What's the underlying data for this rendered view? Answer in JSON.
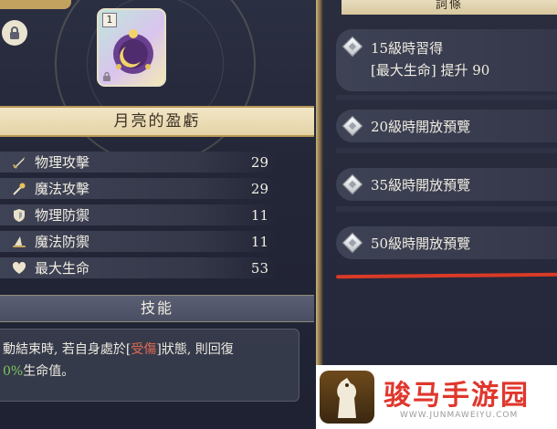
{
  "card": {
    "count": "1"
  },
  "item": {
    "name": "月亮的盈虧"
  },
  "stats": [
    {
      "label": "物理攻擊",
      "value": "29",
      "icon": "sword-icon"
    },
    {
      "label": "魔法攻擊",
      "value": "29",
      "icon": "wand-icon"
    },
    {
      "label": "物理防禦",
      "value": "11",
      "icon": "shield-icon"
    },
    {
      "label": "魔法防禦",
      "value": "11",
      "icon": "hat-icon"
    },
    {
      "label": "最大生命",
      "value": "53",
      "icon": "heart-icon"
    }
  ],
  "skill": {
    "header": "技能",
    "line1_pre": "動結束時, 若自身處於[",
    "line1_hl": "受傷",
    "line1_post": "]狀態, 則回復",
    "line2_hl": "0%",
    "line2_post": "生命值。"
  },
  "terms": {
    "header": "詞條",
    "items": [
      {
        "label": "15級時習得",
        "sub": "[最大生命] 提升 90"
      },
      {
        "label": "20級時開放預覽"
      },
      {
        "label": "35級時開放預覽"
      },
      {
        "label": "50級時開放預覽"
      }
    ]
  },
  "watermark": {
    "brand": "骏马手游园",
    "url": "WWW.JUNMAWEIYU.COM"
  },
  "colors": {
    "accent_gold": "#c3a25f",
    "highlight_red": "#e26b52",
    "highlight_green": "#7ec45a",
    "annotation_red": "#d93a26"
  }
}
